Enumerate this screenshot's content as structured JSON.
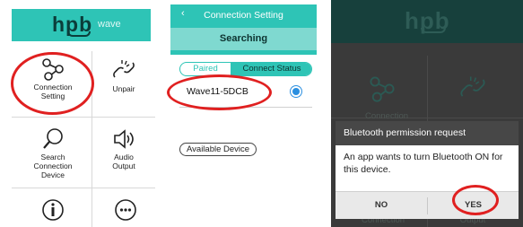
{
  "panel1": {
    "logo": "hpb",
    "logo_suffix": "wave",
    "tiles": [
      {
        "label": "Connection\nSetting",
        "icon": "share-nodes-icon"
      },
      {
        "label": "Unpair",
        "icon": "broken-link-icon"
      },
      {
        "label": "Search\nConnection\nDevice",
        "icon": "magnifier-icon"
      },
      {
        "label": "Audio\nOutput",
        "icon": "speaker-icon"
      },
      {
        "label": "",
        "icon": "info-icon"
      },
      {
        "label": "",
        "icon": "more-dots-icon"
      }
    ]
  },
  "panel2": {
    "back_icon": "‹",
    "title": "Connection Setting",
    "subtitle": "Searching",
    "segment": {
      "left": "Paired",
      "right": "Connect Status"
    },
    "device": "Wave11-5DCB",
    "available_button": "Available Device"
  },
  "panel3": {
    "logo": "hpb",
    "bg_labels": [
      "Connection",
      "Connection",
      "Output"
    ],
    "dialog": {
      "title": "Bluetooth permission request",
      "message": "An app wants to turn Bluetooth ON for this device.",
      "no": "NO",
      "yes": "YES"
    }
  },
  "colors": {
    "accent": "#2ec4b6",
    "highlight_circle": "#e02020",
    "dialog_title_bg": "#474747"
  }
}
